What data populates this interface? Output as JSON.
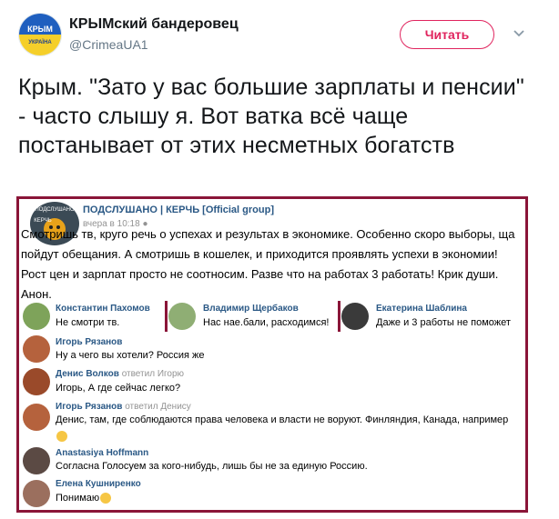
{
  "tweet": {
    "display_name": "КРЫМский бандеровец",
    "handle": "@CrimeaUA1",
    "avatar_text_top": "КРЫМ",
    "avatar_text_bottom": "УКРАЇНА",
    "follow_label": "Читать",
    "text": "Крым. \"Зато у вас большие зарплаты и пенсии\" - часто слышу я. Вот ватка всё чаще постанывает от этих несметных богатств"
  },
  "vk": {
    "group_name": "ПОДСЛУШАНО | КЕРЧЬ [Official group]",
    "post_time": "вчера в 10:18",
    "avatar_label_top": "ПОДСЛУШАНО",
    "avatar_label_bottom": "КЕРЧЬ",
    "post_text": "Смотришь тв, круго речь о успехах и результах в экономике. Особенно скоро выборы, ща пойдут обещания. А смотришь в кошелек, и приходится проявлять успехи в экономии! Рост цен и зарплат просто не соотносим. Разве что на работах 3 работать! Крик души. Анон.",
    "comments_row1": [
      {
        "name": "Константин Пахомов",
        "text": "Не смотри тв."
      },
      {
        "name": "Владимир Щербаков",
        "text": "Нас нае.бали, расходимся!"
      },
      {
        "name": "Екатерина Шаблина",
        "text": "Даже и 3 работы не поможет"
      }
    ],
    "comments": [
      {
        "name": "Игорь Рязанов",
        "reply": "",
        "text": "Ну а чего вы хотели? Россия же"
      },
      {
        "name": "Денис Волков",
        "reply": "ответил Игорю",
        "text": "Игорь, А где сейчас легко?"
      },
      {
        "name": "Игорь Рязанов",
        "reply": "ответил Денису",
        "text": "Денис, там, где соблюдаются права человека и власти не воруют. Финляндия, Канада, например"
      },
      {
        "name": "Anastasiya Hoffmann",
        "reply": "",
        "text": "Согласна  Голосуем за кого-нибудь, лишь бы не за единую Россию."
      },
      {
        "name": "Елена Кушниренко",
        "reply": "",
        "text": "Понимаю"
      }
    ]
  },
  "colors": {
    "accent": "#e0245e",
    "frame": "#8a1538",
    "vk_link": "#2a5885"
  }
}
